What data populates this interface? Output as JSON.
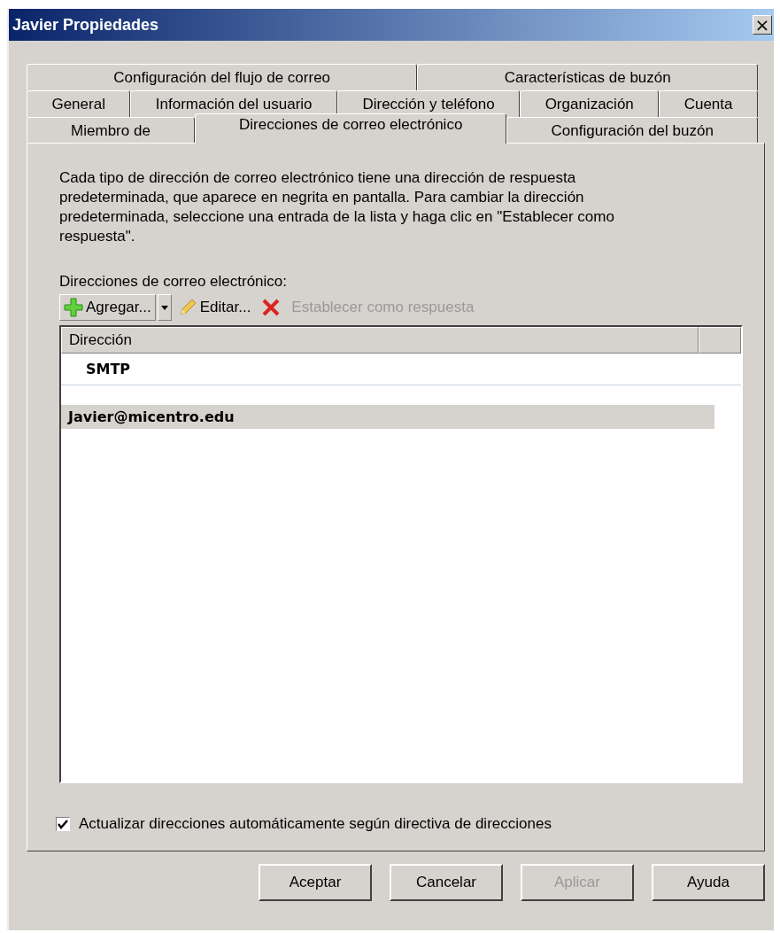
{
  "window": {
    "title": "Javier Propiedades",
    "close": "×"
  },
  "tab_rows": [
    [
      {
        "label": "Configuración del flujo de correo",
        "selected": false
      },
      {
        "label": "Características de buzón",
        "selected": false
      }
    ],
    [
      {
        "label": "General",
        "selected": false
      },
      {
        "label": "Información del usuario",
        "selected": false
      },
      {
        "label": "Dirección y teléfono",
        "selected": false
      },
      {
        "label": "Organización",
        "selected": false
      },
      {
        "label": "Cuenta",
        "selected": false
      }
    ],
    [
      {
        "label": "Miembro de",
        "selected": false
      },
      {
        "label": "Direcciones de correo electrónico",
        "selected": true
      },
      {
        "label": "Configuración del buzón",
        "selected": false
      }
    ]
  ],
  "description": "Cada tipo de dirección de correo electrónico tiene una dirección de respuesta predeterminada, que aparece en negrita en pantalla. Para cambiar la dirección predeterminada, seleccione una entrada de la lista y haga clic en \"Establecer como respuesta\".",
  "list_label": "Direcciones de correo electrónico:",
  "toolbar": [
    {
      "kind": "add",
      "label": "Agregar...",
      "disabled": false
    },
    {
      "kind": "dropdown",
      "disabled": false
    },
    {
      "kind": "edit",
      "label": "Editar...",
      "disabled": false
    },
    {
      "kind": "remove",
      "disabled": false
    },
    {
      "kind": "text",
      "label": "Establecer como respuesta",
      "disabled": true
    }
  ],
  "table": {
    "columns": [
      "Dirección"
    ],
    "rows": [
      {
        "kind": "group",
        "text": "SMTP",
        "selected": false
      },
      {
        "kind": "address",
        "text": "Javier@micentro.edu",
        "selected": true
      }
    ]
  },
  "auto_update": {
    "label": "Actualizar direcciones automáticamente según directiva de direcciones",
    "checked": true
  },
  "buttons": [
    {
      "label": "Aceptar",
      "disabled": false
    },
    {
      "label": "Cancelar",
      "disabled": false
    },
    {
      "label": "Aplicar",
      "disabled": true
    },
    {
      "label": "Ayuda",
      "disabled": false
    }
  ]
}
